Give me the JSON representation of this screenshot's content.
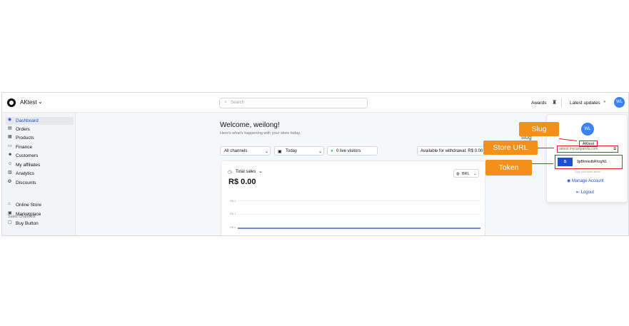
{
  "topbar": {
    "store_name": "AKtest",
    "search_placeholder": "Search",
    "awards": "Awards",
    "latest_updates": "Latest updates",
    "avatar_initials": "WL"
  },
  "sidebar": {
    "items": [
      {
        "label": "Dashboard",
        "icon": "dashboard-icon"
      },
      {
        "label": "Orders",
        "icon": "orders-icon"
      },
      {
        "label": "Products",
        "icon": "products-icon"
      },
      {
        "label": "Finance",
        "icon": "finance-icon"
      },
      {
        "label": "Customers",
        "icon": "customers-icon"
      },
      {
        "label": "My affiliates",
        "icon": "affiliates-icon"
      },
      {
        "label": "Analytics",
        "icon": "analytics-icon"
      },
      {
        "label": "Discounts",
        "icon": "discounts-icon"
      }
    ],
    "section_label": "Sales Channels",
    "channels": [
      {
        "label": "Online Store",
        "icon": "store-icon"
      },
      {
        "label": "Marketplace",
        "icon": "marketplace-icon"
      },
      {
        "label": "Buy Button",
        "icon": "buy-button-icon"
      }
    ]
  },
  "main": {
    "welcome": "Welcome, weilong!",
    "welcome_sub": "Here's what's happening with your store today.",
    "channels_filter": "All channels",
    "date_filter": "Today",
    "live_visitors": "0 live visitors",
    "withdrawal": "Available for withdrawal: R$ 0.00"
  },
  "sales_card": {
    "title": "Total sales",
    "value": "R$ 0.00",
    "currency": "BRL",
    "y_ticks": [
      "R$ 2",
      "R$ 1",
      "R$ 0"
    ]
  },
  "chart_data": {
    "type": "line",
    "title": "Total sales",
    "y_ticks": [
      "R$ 2",
      "R$ 1",
      "R$ 0"
    ],
    "ylim": [
      0,
      2
    ],
    "series": [
      {
        "values": [
          0,
          0,
          0,
          0,
          0,
          0,
          0,
          0,
          0,
          0,
          0,
          0,
          0,
          0,
          0,
          0,
          0,
          0,
          0,
          0,
          0,
          0,
          0,
          0
        ]
      }
    ]
  },
  "account_panel": {
    "avatar_initials": "WL",
    "slug": "AKtest",
    "store_url": "aktest.mycartpanda.com",
    "token": "9pBImledbRhzgN1",
    "copy_hint": "Copy your token above",
    "manage_account": "Manage Account",
    "logout": "Logout"
  },
  "callouts": {
    "slug": "Slug",
    "store_url": "Store URL",
    "token": "Token",
    "ghost_slug": "slug"
  },
  "colors": {
    "accent": "#1d4ed8",
    "callout": "#f39019",
    "highlight_border": "#e11d2a",
    "avatar": "#3b82f6"
  }
}
